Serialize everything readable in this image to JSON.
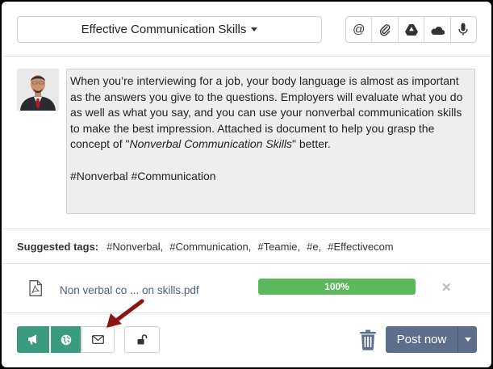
{
  "header": {
    "title_dropdown": "Effective Communication Skills",
    "tools": [
      "at-sign-icon",
      "paperclip-icon",
      "google-drive-icon",
      "onedrive-icon",
      "microphone-icon"
    ]
  },
  "post": {
    "body_part1": "When you’re interviewing for a job, your body language is almost as important as the answers you give to the questions. Employers will evaluate what you do as well as what you say, and you can use your nonverbal communication skills to make the best impression. Attached is document to help you grasp the concept of \"",
    "body_italic": "Nonverbal Communication Skills",
    "body_part2": "\" better.",
    "hashtags": "#Nonverbal #Communication"
  },
  "suggested": {
    "label": "Suggested tags:",
    "tags": [
      "#Nonverbal,",
      "#Communication,",
      "#Teamie,",
      "#e,",
      "#Effectivecom"
    ]
  },
  "attachment": {
    "file_name": "Non verbal co ... on skills.pdf",
    "progress_label": "100%",
    "progress_fraction": 1.0,
    "close_glyph": "✕"
  },
  "footer": {
    "post_button": "Post now"
  },
  "colors": {
    "accent_green": "#3a9b81",
    "progress_green": "#5cb85c",
    "post_button": "#5c6e89",
    "arrow_red": "#8e1515"
  }
}
